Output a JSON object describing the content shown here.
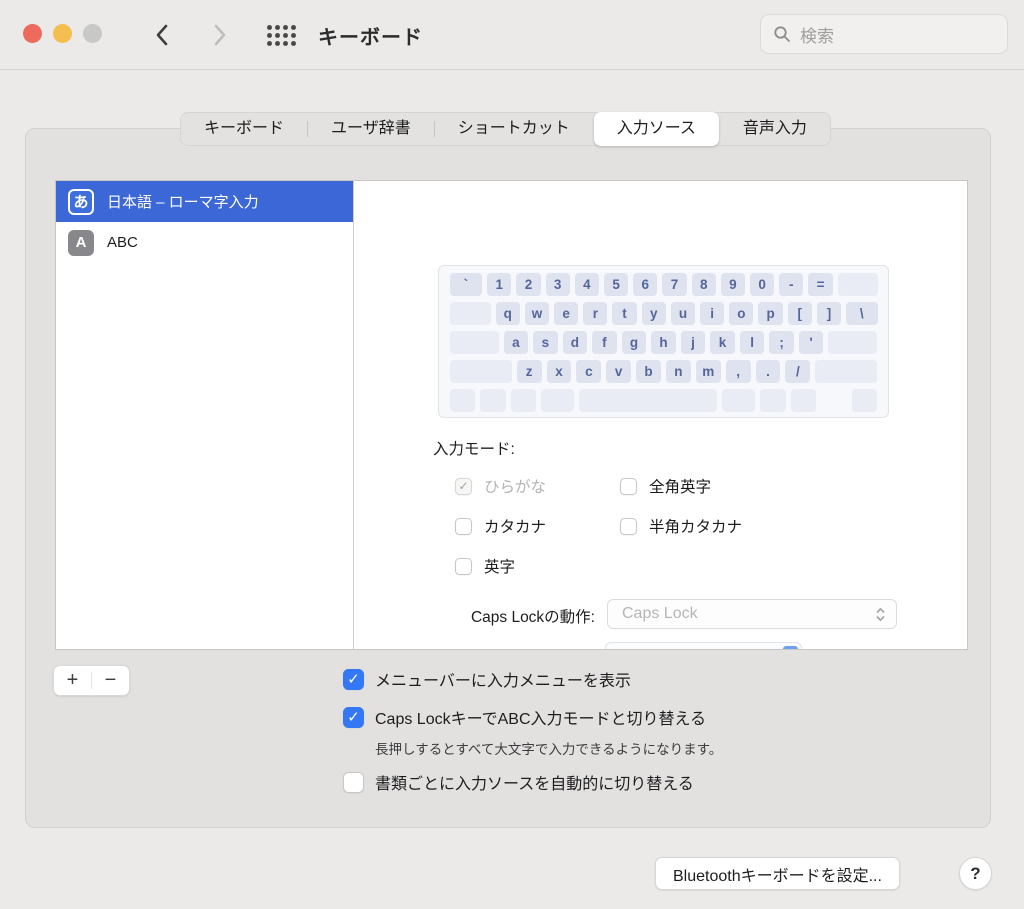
{
  "window": {
    "title": "キーボード"
  },
  "toolbar": {
    "search_placeholder": "検索",
    "icons": {
      "back": "chevron-left",
      "forward": "chevron-right",
      "apps": "grid-dots",
      "search": "magnifier"
    }
  },
  "tabs": [
    {
      "label": "キーボード",
      "selected": false
    },
    {
      "label": "ユーザ辞書",
      "selected": false
    },
    {
      "label": "ショートカット",
      "selected": false
    },
    {
      "label": "入力ソース",
      "selected": true
    },
    {
      "label": "音声入力",
      "selected": false
    }
  ],
  "input_sources": [
    {
      "badge": "あ",
      "badge_style": "jp",
      "label": "日本語 – ローマ字入力",
      "selected": true
    },
    {
      "badge": "A",
      "badge_style": "abc",
      "label": "ABC",
      "selected": false
    }
  ],
  "keyboard_preview": {
    "rows": [
      [
        {
          "k": "`",
          "w": 1.35
        },
        {
          "k": "1"
        },
        {
          "k": "2"
        },
        {
          "k": "3"
        },
        {
          "k": "4"
        },
        {
          "k": "5"
        },
        {
          "k": "6"
        },
        {
          "k": "7"
        },
        {
          "k": "8"
        },
        {
          "k": "9"
        },
        {
          "k": "0"
        },
        {
          "k": "-"
        },
        {
          "k": "="
        },
        {
          "k": "",
          "w": 1.65,
          "t": "blank"
        }
      ],
      [
        {
          "k": "",
          "w": 1.7,
          "t": "blank"
        },
        {
          "k": "q"
        },
        {
          "k": "w"
        },
        {
          "k": "e"
        },
        {
          "k": "r"
        },
        {
          "k": "t"
        },
        {
          "k": "y"
        },
        {
          "k": "u"
        },
        {
          "k": "i"
        },
        {
          "k": "o"
        },
        {
          "k": "p"
        },
        {
          "k": "["
        },
        {
          "k": "]"
        },
        {
          "k": "\\",
          "w": 1.3
        }
      ],
      [
        {
          "k": "",
          "w": 2,
          "t": "blank"
        },
        {
          "k": "a"
        },
        {
          "k": "s"
        },
        {
          "k": "d"
        },
        {
          "k": "f"
        },
        {
          "k": "g"
        },
        {
          "k": "h"
        },
        {
          "k": "j"
        },
        {
          "k": "k"
        },
        {
          "k": "l"
        },
        {
          "k": ";"
        },
        {
          "k": "'"
        },
        {
          "k": "",
          "w": 2,
          "t": "blank"
        }
      ],
      [
        {
          "k": "",
          "w": 2.5,
          "t": "blank"
        },
        {
          "k": "z"
        },
        {
          "k": "x"
        },
        {
          "k": "c"
        },
        {
          "k": "v"
        },
        {
          "k": "b"
        },
        {
          "k": "n"
        },
        {
          "k": "m"
        },
        {
          "k": ","
        },
        {
          "k": "."
        },
        {
          "k": "/"
        },
        {
          "k": "",
          "w": 2.5,
          "t": "blank"
        }
      ],
      [
        {
          "k": "",
          "t": "blank"
        },
        {
          "k": "",
          "t": "blank"
        },
        {
          "k": "",
          "t": "blank"
        },
        {
          "k": "",
          "w": 1.3,
          "t": "blank"
        },
        {
          "k": "",
          "w": 5.4,
          "t": "space"
        },
        {
          "k": "",
          "w": 1.3,
          "t": "blank"
        },
        {
          "k": "",
          "t": "blank"
        },
        {
          "k": "",
          "t": "blank"
        },
        {
          "k": "",
          "t": "split"
        },
        {
          "k": "",
          "t": "blank"
        }
      ]
    ]
  },
  "input_mode": {
    "label": "入力モード:",
    "options": [
      {
        "label": "ひらがな",
        "checked": true,
        "disabled": true
      },
      {
        "label": "全角英字",
        "checked": false,
        "disabled": false
      },
      {
        "label": "カタカナ",
        "checked": false,
        "disabled": false
      },
      {
        "label": "半角カタカナ",
        "checked": false,
        "disabled": false
      },
      {
        "label": "英字",
        "checked": false,
        "disabled": false
      }
    ]
  },
  "caps_lock_action": {
    "label": "Caps Lockの動作:",
    "value": "Caps Lock",
    "disabled": true
  },
  "list_actions": {
    "add": "+",
    "remove": "−"
  },
  "options": [
    {
      "label": "メニューバーに入力メニューを表示",
      "checked": true
    },
    {
      "label": "Caps LockキーでABC入力モードと切り替える",
      "checked": true,
      "note": "長押しするとすべて大文字で入力できるようになります。"
    },
    {
      "label": "書類ごとに入力ソースを自動的に切り替える",
      "checked": false
    }
  ],
  "footer": {
    "bluetooth_button": "Bluetoothキーボードを設定...",
    "help_button": "?"
  },
  "colors": {
    "selection_blue": "#3b68d6",
    "checkbox_blue": "#3478f6",
    "key_text": "#55669b",
    "traffic_red": "#ec6b5d",
    "traffic_yellow": "#f5bf50"
  }
}
